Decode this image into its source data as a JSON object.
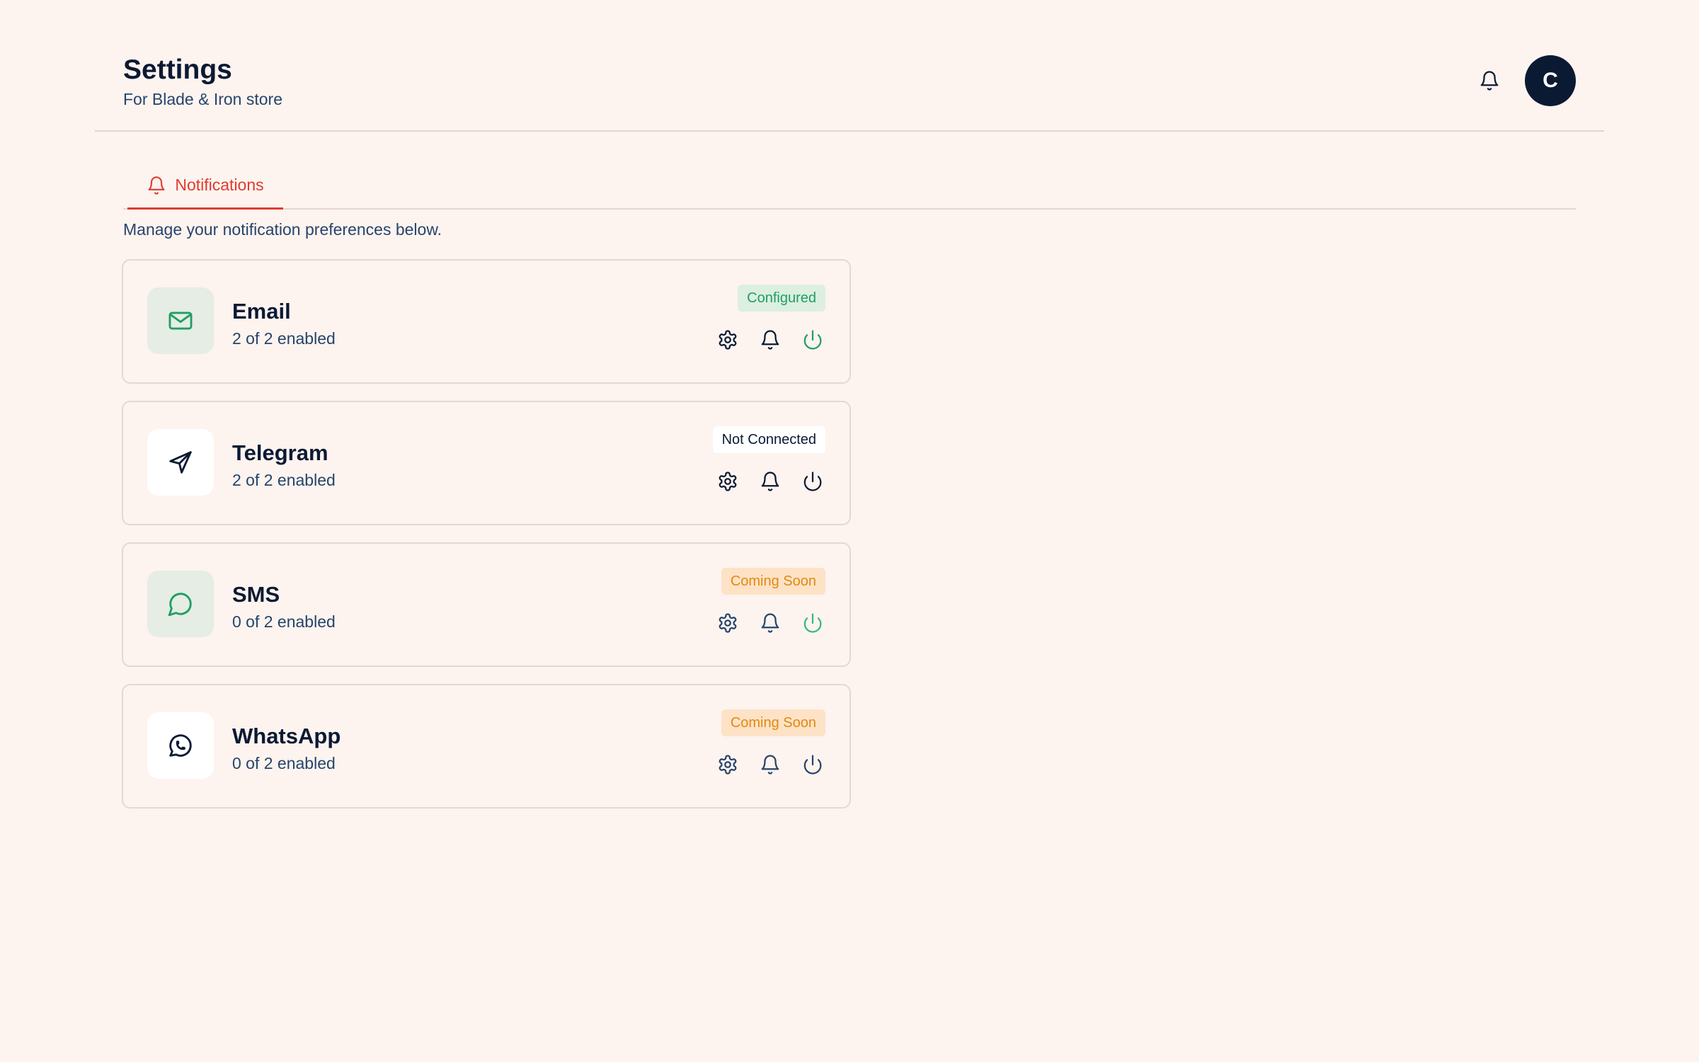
{
  "header": {
    "title": "Settings",
    "subtitle": "For Blade & Iron store",
    "notifications_icon": "bell-icon",
    "avatar_initial": "C"
  },
  "tabs": [
    {
      "label": "Notifications",
      "icon": "bell-icon",
      "active": true
    }
  ],
  "intro": "Manage your notification preferences below.",
  "colors": {
    "background": "#fdf3ef",
    "accent": "#e03b2f",
    "success": "#1f9e63",
    "warning": "#e3890f",
    "navy": "#0b1a33"
  },
  "channels": [
    {
      "name": "Email",
      "count": "2 of 2 enabled",
      "status": "Configured",
      "icon": "mail-icon",
      "power_active": true
    },
    {
      "name": "Telegram",
      "count": "2 of 2 enabled",
      "status": "Not Connected",
      "icon": "send-icon",
      "power_active": false
    },
    {
      "name": "SMS",
      "count": "0 of 2 enabled",
      "status": "Coming Soon",
      "icon": "chat-bubble-icon",
      "power_active": true
    },
    {
      "name": "WhatsApp",
      "count": "0 of 2 enabled",
      "status": "Coming Soon",
      "icon": "whatsapp-icon",
      "power_active": false
    }
  ]
}
